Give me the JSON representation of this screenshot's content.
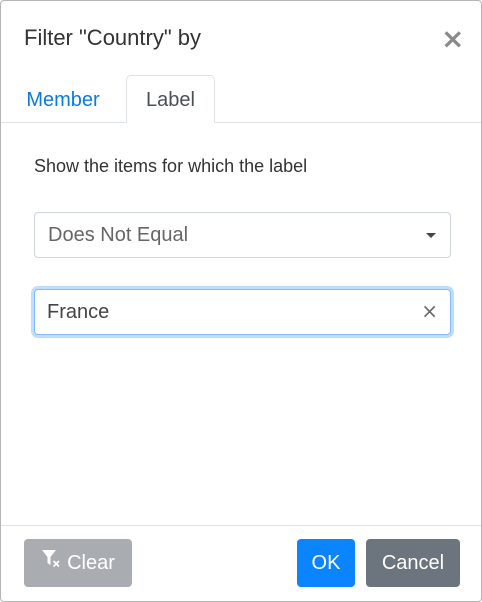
{
  "dialog": {
    "title": "Filter \"Country\" by",
    "close_icon": "close-icon"
  },
  "tabs": [
    {
      "label": "Member",
      "active": false
    },
    {
      "label": "Label",
      "active": true
    }
  ],
  "body": {
    "prompt": "Show the items for which the label",
    "condition": {
      "selected": "Does Not Equal",
      "icon": "chevron-down-icon"
    },
    "value_input": {
      "value": "France",
      "clear_icon": "clear-icon"
    }
  },
  "footer": {
    "clear_label": "Clear",
    "clear_icon": "filter-clear-icon",
    "ok_label": "OK",
    "cancel_label": "Cancel"
  },
  "colors": {
    "accent": "#0a84ff",
    "tab_link": "#0a7bdc",
    "cancel": "#6c757d",
    "clear_disabled": "#a9adb2"
  }
}
